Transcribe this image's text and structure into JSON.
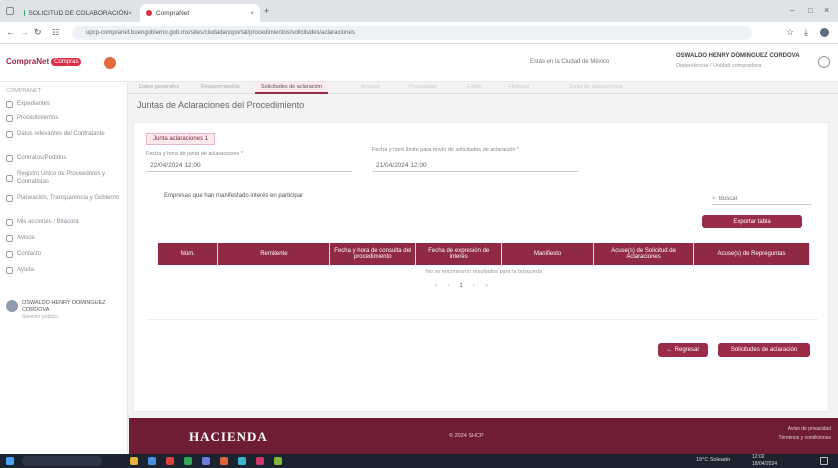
{
  "browser": {
    "tabs": [
      {
        "label": "SOLICITUD DE COLABORACIÓN"
      },
      {
        "label": "CompraNet"
      }
    ],
    "url": "upcp-compranet.buengobierno.gob.mx/sites/ciudadanoportal/procedimientos/solicitudes/aclaraciones"
  },
  "header": {
    "logo_left": "CompraNet",
    "logo_right": "Compras",
    "date_text": "Estás en la Ciudad de México",
    "user_name": "OSWALDO HENRY DOMINGUEZ CORDOVA",
    "user_sub": "Dependencia / Unidad compradora"
  },
  "sidebar": {
    "section_label": "COMPRANET",
    "items": [
      {
        "label": "Expedientes",
        "icon": "folder-icon"
      },
      {
        "label": "Procedimientos",
        "icon": "list-icon"
      },
      {
        "label": "Datos relevantes del Contratante",
        "icon": "file-icon"
      },
      {
        "label": "Contratos/Pedidos",
        "icon": "contract-icon"
      },
      {
        "label": "Registro Unico de Proveedores y Contratistas",
        "icon": "registry-icon"
      },
      {
        "label": "Planeación, Transparencia y Gobierno",
        "icon": "chart-icon"
      },
      {
        "label": "Mis acciones / Bitácora",
        "icon": "history-icon"
      },
      {
        "label": "Avisos",
        "icon": "bell-icon"
      },
      {
        "label": "Contacto",
        "icon": "mail-icon"
      },
      {
        "label": "Ayuda",
        "icon": "help-icon"
      }
    ],
    "user_name": "OSWALDO HENRY DOMINGUEZ CORDOVA",
    "user_role": "Servidor público"
  },
  "tabs": [
    {
      "label": "Datos generales"
    },
    {
      "label": "Requerimientos"
    },
    {
      "label": "Solicitudes de aclaración"
    },
    {
      "label": "Anexos"
    },
    {
      "label": "Propuestas"
    },
    {
      "label": "Fallos"
    },
    {
      "label": "Historial"
    },
    {
      "label": "Junta de aclaraciones"
    }
  ],
  "page_title": "Juntas de Aclaraciones del Procedimiento",
  "junta_tab": "Junta aclaraciones 1",
  "field1": {
    "label": "Fecha y hora de junta de aclaraciones *",
    "value": "22/04/2024 12:00"
  },
  "field2": {
    "label": "Fecha y hora límite para envío de solicitudes de aclaración *",
    "value": "21/04/2024 12:00"
  },
  "empresas_label": "Empresas que han manifestado interés en participar",
  "search": {
    "placeholder": "Buscar"
  },
  "export_button": "Exportar tabla",
  "table": {
    "headers": [
      "Núm.",
      "Remitente",
      "Fecha y hora de consulta del procedimiento",
      "Fecha de expresión de interés",
      "Manifiesto",
      "Acuse(s) de Solicitud de Aclaraciones",
      "Acuse(s) de Repreguntas"
    ],
    "empty_text": "No se encontraron resultados para la búsqueda",
    "pagination": {
      "current": "1"
    }
  },
  "buttons": {
    "back": "Regresar",
    "requests": "Solicitudes de aclaración"
  },
  "footer": {
    "brand": "HACIENDA",
    "center": "© 2024 SHCP",
    "right1": "Aviso de privacidad",
    "right2": "Términos y condiciones"
  },
  "taskbar": {
    "weather": "19°C Soleado",
    "time": "12:02",
    "date": "18/04/2024"
  },
  "colors": {
    "primary": "#9b2c47",
    "header_th": "#8f2a42",
    "footer": "#6e1d35"
  }
}
